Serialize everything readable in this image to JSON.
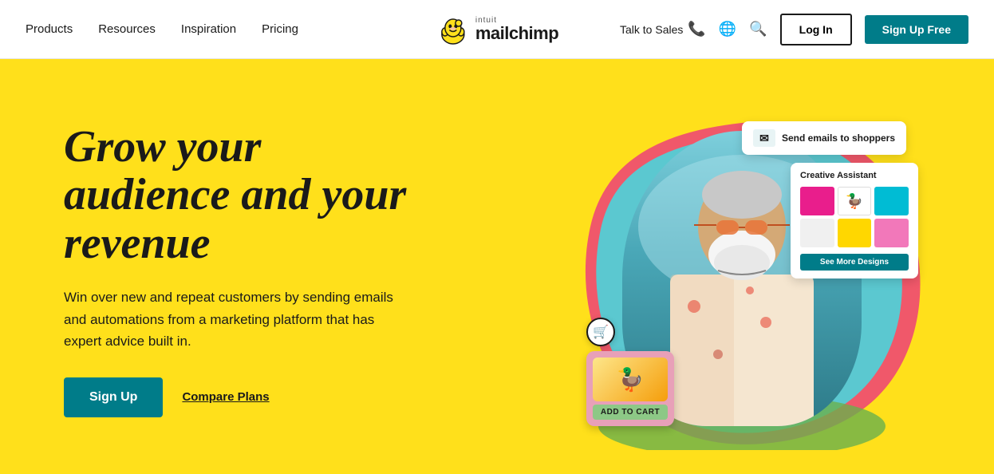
{
  "nav": {
    "items": [
      {
        "label": "Products",
        "id": "products"
      },
      {
        "label": "Resources",
        "id": "resources"
      },
      {
        "label": "Inspiration",
        "id": "inspiration"
      },
      {
        "label": "Pricing",
        "id": "pricing"
      }
    ],
    "logo_intuit": "intuit",
    "logo_mailchimp": "mailchimp",
    "talk_to_sales": "Talk to Sales",
    "login_label": "Log In",
    "signup_label": "Sign Up Free"
  },
  "hero": {
    "heading_line1": "Grow your",
    "heading_line2": "audience and your",
    "heading_line3": "revenue",
    "subtext": "Win over new and repeat customers by sending emails and automations from a marketing platform that has expert advice built in.",
    "cta_signup": "Sign Up",
    "cta_compare": "Compare Plans"
  },
  "cards": {
    "email_label": "Send emails to shoppers",
    "creative_title": "Creative Assistant",
    "creative_btn": "See More Designs",
    "add_to_cart": "ADD TO CART"
  },
  "colors": {
    "hero_bg": "#FFE01B",
    "teal": "#007C89",
    "nav_bg": "#ffffff"
  }
}
